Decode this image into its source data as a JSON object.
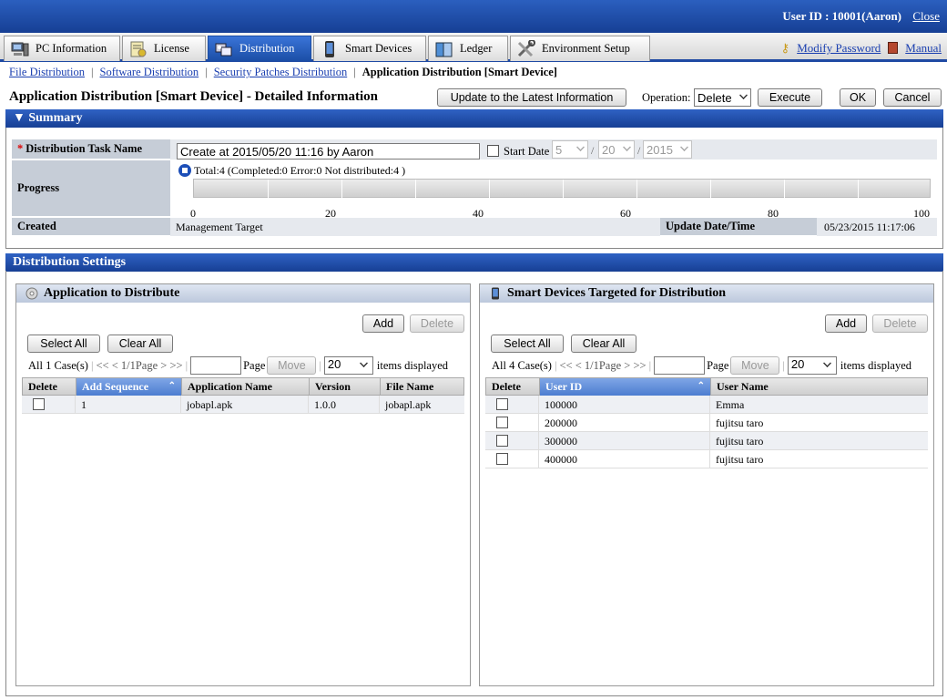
{
  "header": {
    "user_id": "User ID : 10001(Aaron)",
    "close": "Close"
  },
  "tabs": [
    {
      "label": "PC Information",
      "icon": "pc-icon"
    },
    {
      "label": "License",
      "icon": "license-icon"
    },
    {
      "label": "Distribution",
      "icon": "distribution-icon",
      "active": true
    },
    {
      "label": "Smart Devices",
      "icon": "smartphone-icon"
    },
    {
      "label": "Ledger",
      "icon": "ledger-icon"
    },
    {
      "label": "Environment Setup",
      "icon": "tools-icon"
    }
  ],
  "links": {
    "modify_password": "Modify Password",
    "manual": "Manual"
  },
  "subnav": {
    "file": "File Distribution",
    "software": "Software Distribution",
    "security": "Security Patches Distribution",
    "current": "Application Distribution [Smart Device]"
  },
  "page": {
    "title": "Application Distribution [Smart Device] - Detailed Information",
    "update_btn": "Update to the Latest Information",
    "operation_label": "Operation:",
    "operation_value": "Delete",
    "execute": "Execute",
    "ok": "OK",
    "cancel": "Cancel"
  },
  "summary": {
    "heading": "▼ Summary",
    "task_label": "Distribution Task Name",
    "required_mark": "*",
    "task_value": "Create at 2015/05/20 11:16 by Aaron",
    "start_date_label": "Start Date",
    "start_month": "5",
    "start_day": "20",
    "start_year": "2015",
    "date_sep": "/",
    "progress_label": "Progress",
    "progress_text": "Total:4  (Completed:0  Error:0  Not distributed:4 )",
    "progress_value": 0,
    "ticks": [
      "0",
      "20",
      "40",
      "60",
      "80",
      "100"
    ],
    "created_label": "Created",
    "created_value": "Management Target",
    "updated_label": "Update Date/Time",
    "updated_value": "05/23/2015 11:17:06"
  },
  "settings": {
    "heading": "Distribution Settings",
    "apps": {
      "title": "Application to Distribute",
      "add": "Add",
      "delete": "Delete",
      "select_all": "Select All",
      "clear_all": "Clear All",
      "count": "All 1 Case(s)",
      "nav": "<< < 1/1Page > >>",
      "page_label": "Page",
      "move": "Move",
      "per_page": "20",
      "items_displayed": "items displayed",
      "columns": [
        "Delete",
        "Add Sequence",
        "Application Name",
        "Version",
        "File Name"
      ],
      "rows": [
        {
          "seq": "1",
          "name": "jobapl.apk",
          "version": "1.0.0",
          "file": "jobapl.apk"
        }
      ]
    },
    "devices": {
      "title": "Smart Devices Targeted for Distribution",
      "add": "Add",
      "delete": "Delete",
      "select_all": "Select All",
      "clear_all": "Clear All",
      "count": "All 4 Case(s)",
      "nav": "<< < 1/1Page > >>",
      "page_label": "Page",
      "move": "Move",
      "per_page": "20",
      "items_displayed": "items displayed",
      "columns": [
        "Delete",
        "User ID",
        "User Name"
      ],
      "rows": [
        {
          "uid": "100000",
          "name": "Emma"
        },
        {
          "uid": "200000",
          "name": "fujitsu taro"
        },
        {
          "uid": "300000",
          "name": "fujitsu taro"
        },
        {
          "uid": "400000",
          "name": "fujitsu taro"
        }
      ]
    }
  },
  "colors": {
    "header_blue": "#1f4aa3",
    "link": "#1a3fb0",
    "label_bg": "#c6cdd7"
  }
}
